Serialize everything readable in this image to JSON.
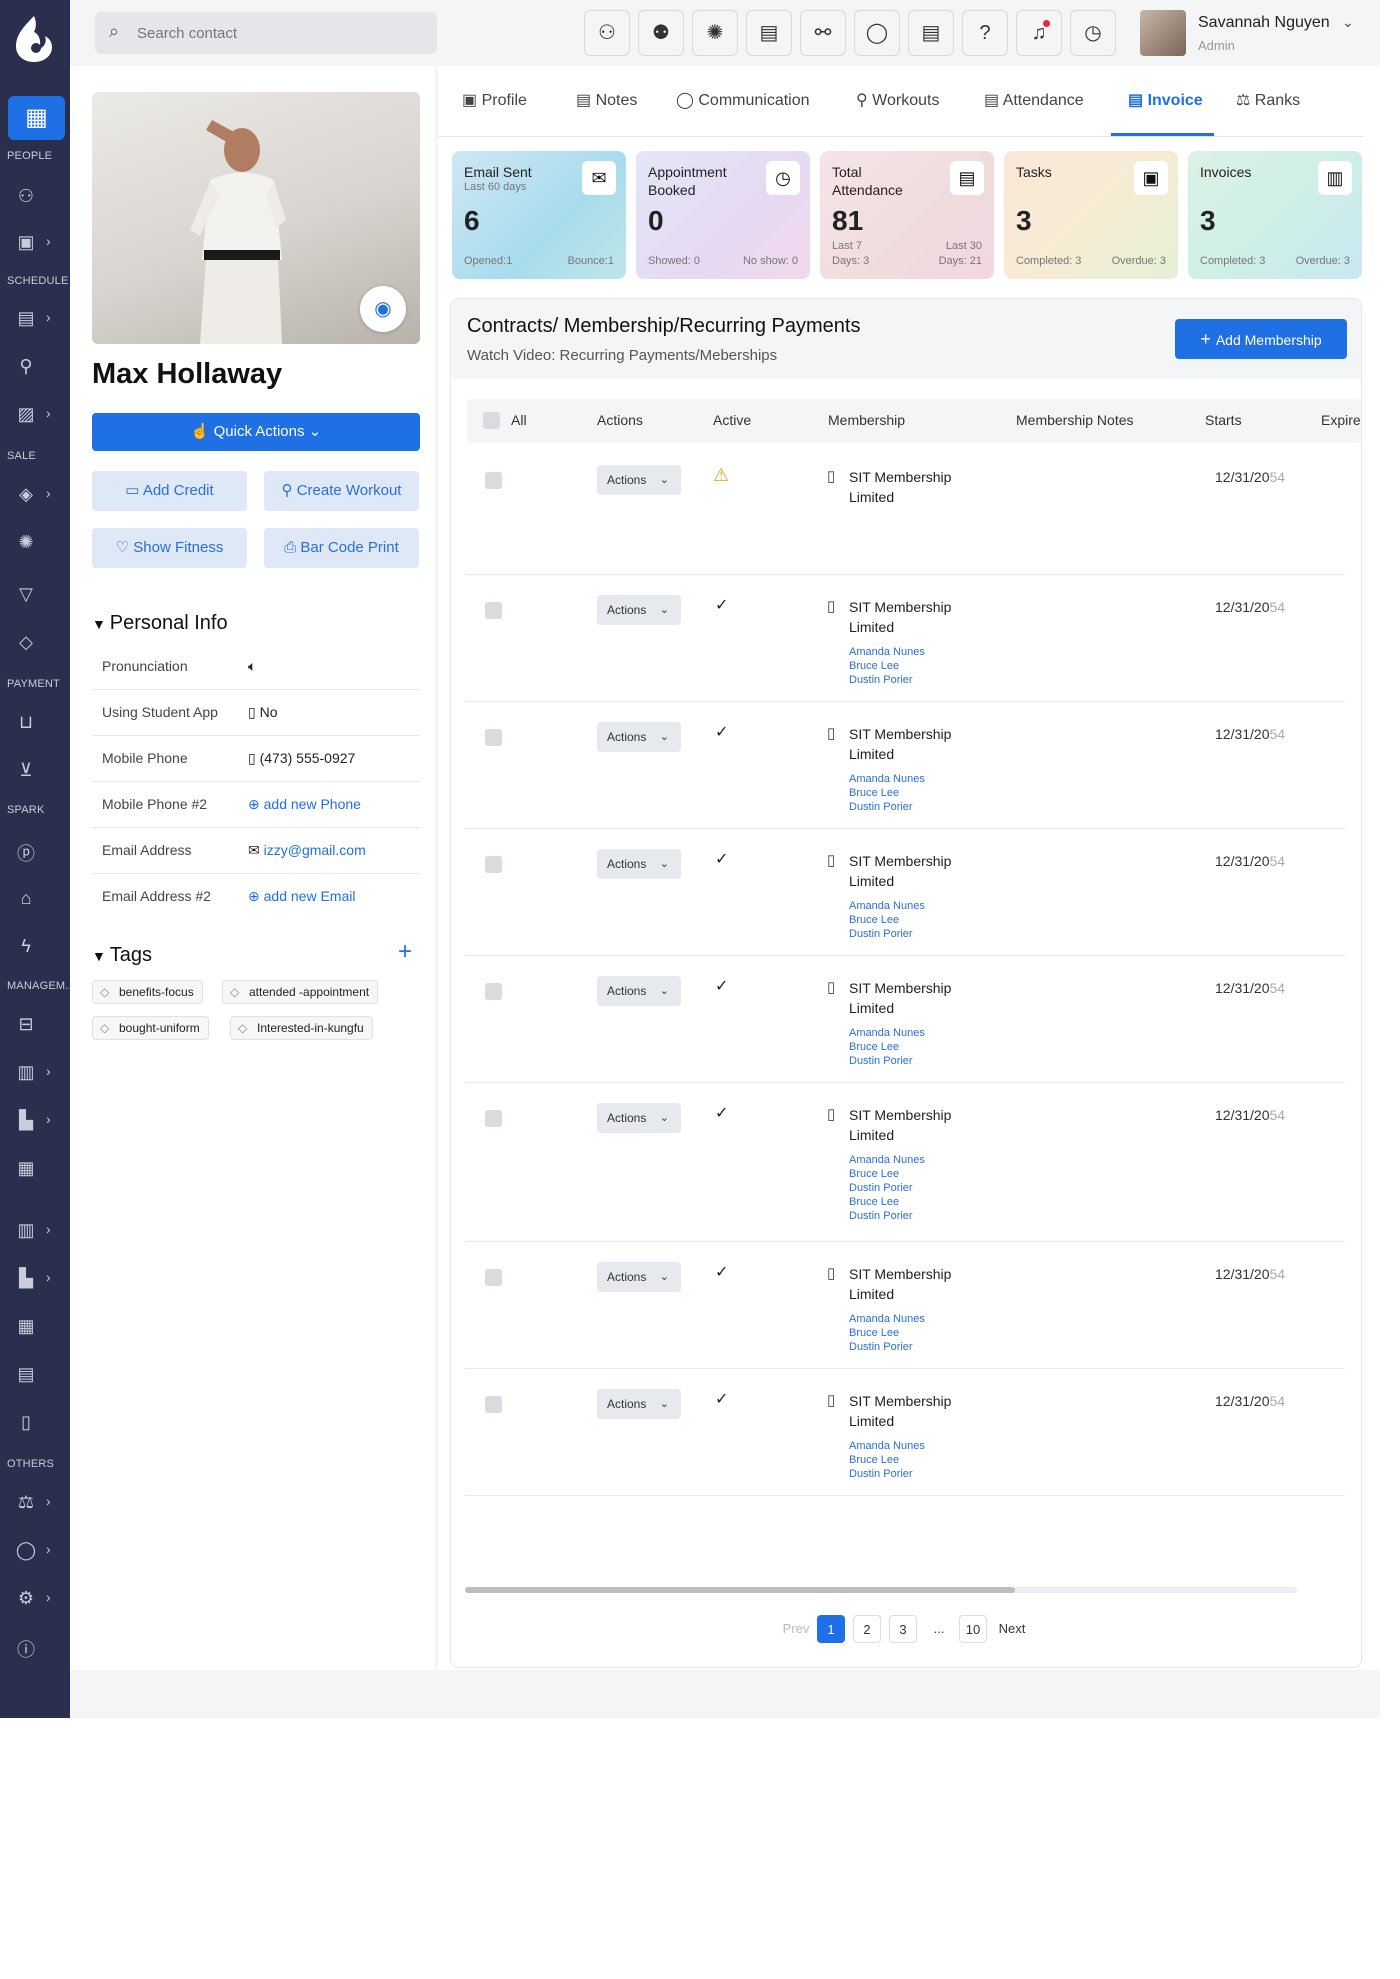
{
  "search": {
    "placeholder": "Search contact"
  },
  "user": {
    "name": "Savannah Nguyen",
    "role": "Admin"
  },
  "nav_sections": [
    "PEOPLE",
    "SCHEDULE",
    "SALE",
    "PAYMENT",
    "SPARK",
    "MANAGEM..",
    "OTHERS"
  ],
  "profile": {
    "name": "Max Hollaway",
    "quick_actions": "Quick Actions",
    "buttons": [
      "Add Credit",
      "Create Workout",
      "Show Fitness",
      "Bar Code Print"
    ]
  },
  "personal_info": {
    "title": "Personal Info",
    "rows": [
      {
        "label": "Pronunciation",
        "value": ""
      },
      {
        "label": "Using Student App",
        "value": "No"
      },
      {
        "label": "Mobile Phone",
        "value": "(473) 555-0927"
      },
      {
        "label": "Mobile Phone #2",
        "value": "add new Phone"
      },
      {
        "label": "Email Address",
        "value": "izzy@gmail.com"
      },
      {
        "label": "Email Address #2",
        "value": "add new Email"
      }
    ]
  },
  "tags": {
    "title": "Tags",
    "items": [
      "benefits-focus",
      "attended -appointment",
      "bought-uniform",
      "Interested-in-kungfu"
    ]
  },
  "tabs": [
    "Profile",
    "Notes",
    "Communication",
    "Workouts",
    "Attendance",
    "Invoice",
    "Ranks"
  ],
  "cards": [
    {
      "title": "Email Sent",
      "sub": "Last 60 days",
      "value": "6",
      "foot_left": "Opened:1",
      "foot_right": "Bounce:1",
      "icon": "mail-icon"
    },
    {
      "title": "Appointment Booked",
      "sub": "",
      "value": "0",
      "foot_left": "Showed: 0",
      "foot_right": "No show: 0",
      "icon": "calendar-clock-icon"
    },
    {
      "title": "Total Attendance",
      "sub": "",
      "value": "81",
      "foot_left": "Last 7 Days: 3",
      "foot_right": "Last 30 Days: 21",
      "icon": "calendar-icon"
    },
    {
      "title": "Tasks",
      "sub": "",
      "value": "3",
      "foot_left": "Completed: 3",
      "foot_right": "Overdue: 3",
      "icon": "clipboard-icon"
    },
    {
      "title": "Invoices",
      "sub": "",
      "value": "3",
      "foot_left": "Completed: 3",
      "foot_right": "Overdue: 3",
      "icon": "invoice-icon"
    }
  ],
  "contracts": {
    "title": "Contracts/ Membership/Recurring Payments",
    "subtitle": "Watch Video: Recurring Payments/Meberships",
    "add_button": "Add Membership",
    "columns": [
      "All",
      "Actions",
      "Active",
      "Membership",
      "Membership Notes",
      "Starts",
      "Expire"
    ],
    "rows": [
      {
        "action": "Actions",
        "active": "warning",
        "membership": "SIT Membership Limited",
        "links": [],
        "start": "12/31/20",
        "start_faded": "54"
      },
      {
        "action": "Actions",
        "active": "check",
        "membership": "SIT Membership Limited",
        "links": [
          "Amanda Nunes",
          "Bruce Lee",
          "Dustin Porier"
        ],
        "start": "12/31/20",
        "start_faded": "54"
      },
      {
        "action": "Actions",
        "active": "check",
        "membership": "SIT Membership Limited",
        "links": [
          "Amanda Nunes",
          "Bruce Lee",
          "Dustin Porier"
        ],
        "start": "12/31/20",
        "start_faded": "54"
      },
      {
        "action": "Actions",
        "active": "check",
        "membership": "SIT Membership Limited",
        "links": [
          "Amanda Nunes",
          "Bruce Lee",
          "Dustin Porier"
        ],
        "start": "12/31/20",
        "start_faded": "54"
      },
      {
        "action": "Actions",
        "active": "check",
        "membership": "SIT Membership Limited",
        "links": [
          "Amanda Nunes",
          "Bruce Lee",
          "Dustin Porier"
        ],
        "start": "12/31/20",
        "start_faded": "54"
      },
      {
        "action": "Actions",
        "active": "check",
        "membership": "SIT Membership Limited",
        "links": [
          "Amanda Nunes",
          "Bruce Lee",
          "Dustin Porier",
          "Bruce Lee",
          "Dustin Porier"
        ],
        "start": "12/31/20",
        "start_faded": "54"
      },
      {
        "action": "Actions",
        "active": "check",
        "membership": "SIT Membership Limited",
        "links": [
          "Amanda Nunes",
          "Bruce Lee",
          "Dustin Porier"
        ],
        "start": "12/31/20",
        "start_faded": "54"
      },
      {
        "action": "Actions",
        "active": "check",
        "membership": "SIT Membership Limited",
        "links": [
          "Amanda Nunes",
          "Bruce Lee",
          "Dustin Porier"
        ],
        "start": "12/31/20",
        "start_faded": "54"
      }
    ]
  },
  "pagination": {
    "prev": "Prev",
    "pages": [
      "1",
      "2",
      "3",
      "...",
      "10"
    ],
    "next": "Next",
    "current": "1"
  },
  "colors": {
    "accent": "#1f6fe5",
    "nav_bg": "#2b2f4e",
    "warning": "#e8a317"
  }
}
